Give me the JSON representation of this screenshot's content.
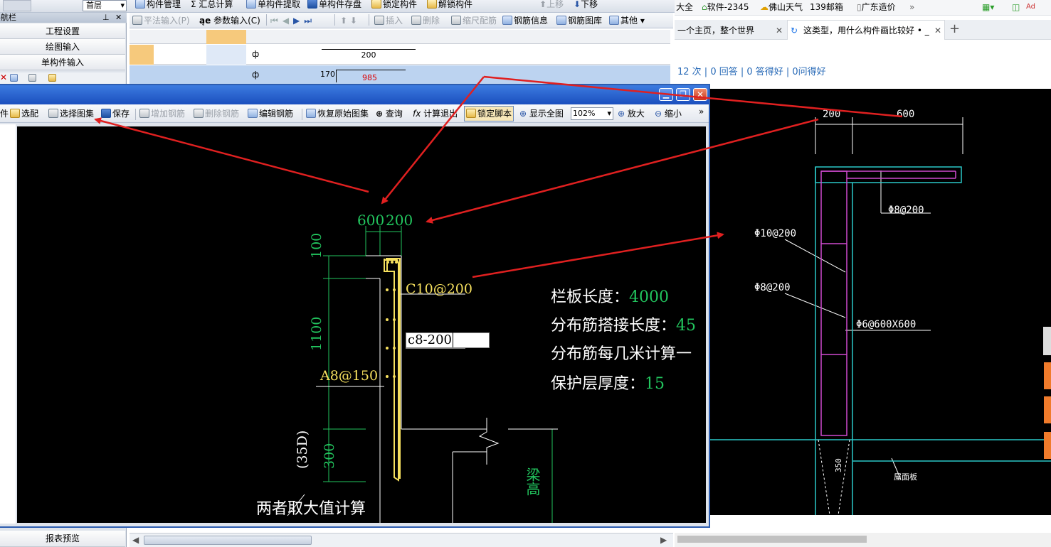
{
  "app_toolbar_top": [
    "构件管理",
    "汇总计算",
    "单构件提取",
    "单构件存盘",
    "锁定构件",
    "解锁构件",
    "上移",
    "下移"
  ],
  "layer_select": "首层",
  "nav_panel": {
    "title": "导航栏",
    "items": [
      "工程设置",
      "绘图输入",
      "单构件输入"
    ],
    "bottom_item": "报表预览"
  },
  "grid_toolbar": [
    "平法输入(P)",
    "参数输入(C)",
    "插入",
    "删除",
    "缩尺配筋",
    "钢筋信息",
    "钢筋图库",
    "其他"
  ],
  "grid_rows": [
    {
      "sym": "ф",
      "dim": "200"
    },
    {
      "sym": "ф",
      "dim_left": "170",
      "dim_right": "985"
    }
  ],
  "editor": {
    "toolbar": [
      "选配",
      "选择图集",
      "保存",
      "增加钢筋",
      "删除钢筋",
      "编辑钢筋",
      "恢复原始图集",
      "查询",
      "计算退出",
      "锁定脚本",
      "显示全图",
      "102%",
      "放大",
      "缩小"
    ],
    "toolbar_first": "件",
    "canvas": {
      "dim_top_left": "600",
      "dim_top_right": "200",
      "dim_100": "100",
      "dim_1100": "1100",
      "dim_300": "300",
      "dim_35d": "(35D)",
      "label_c10": "C10@200",
      "label_a8": "A8@150",
      "input_value": "c8-200",
      "note_max": "两者取大值计算",
      "label_beam_height": "梁高",
      "params": [
        {
          "label": "栏板长度：",
          "value": "4000"
        },
        {
          "label": "分布筋搭接长度：",
          "value": "45"
        },
        {
          "label": "分布筋每几米计算一",
          "value": ""
        },
        {
          "label": "保护层厚度：",
          "value": "15"
        }
      ]
    }
  },
  "browser": {
    "bookmarks": [
      "大全",
      "软件-2345",
      "佛山天气",
      "139邮箱",
      "广东造价"
    ],
    "tabs": [
      {
        "title": "一个主页，整个世界"
      },
      {
        "title": "这类型，用什么构件画比较好 • _"
      }
    ],
    "stats": "12 次 | 0 回答 | 0 答得好 | 0问得好",
    "drawing": {
      "dim_200": "200",
      "dim_600": "600",
      "l1": "Φ8@200",
      "l2": "Φ10@200",
      "l3": "Φ8@200",
      "l4": "Φ6@600X600",
      "l5": "350",
      "l6": "屋面板"
    }
  }
}
